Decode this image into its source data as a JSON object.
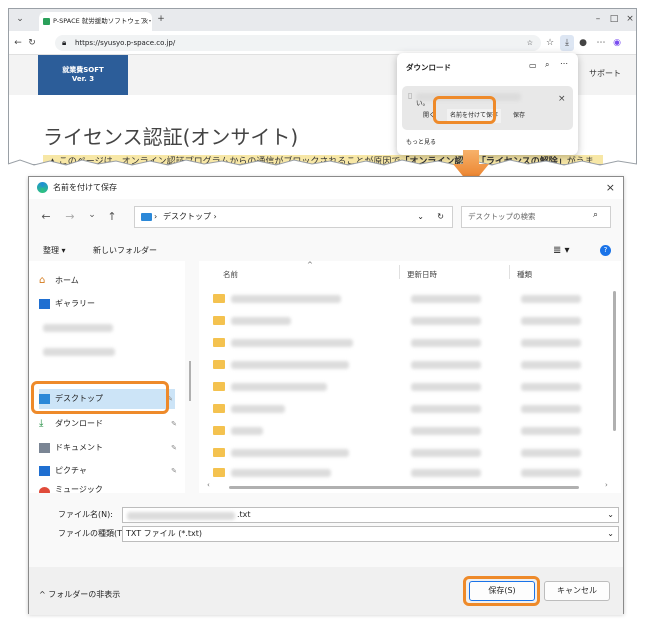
{
  "browser": {
    "tab_title": "P-SPACE 就労援助ソフトウェア・ラ",
    "new_tab_symbol": "+",
    "url": "https://syusyo.p-space.co.jp/",
    "site_logo_line1": "就業費SOFT",
    "site_logo_line2": "Ver. 3",
    "nav_support": "サポート",
    "page_title": "ライセンス認証(オンサイト)",
    "warning_text_1": "このページは、オンライン認証プログラムからの通信がブロックされることが原因で",
    "warning_text_bold1": "「オンライン認証」",
    "warning_text_bold2": "「ライセンスの解除」",
    "warning_text_2": "がうま"
  },
  "downloads": {
    "title": "ダウンロード",
    "item_text": "い。",
    "open_label": "開く",
    "save_as_label": "名前を付けて保存",
    "save_label": "保存",
    "more_label": "もっと見る"
  },
  "dialog": {
    "title": "名前を付けて保存",
    "path_label": "デスクトップ",
    "search_placeholder": "デスクトップの検索",
    "organize_label": "整理 ▾",
    "new_folder_label": "新しいフォルダー",
    "nav_items": [
      {
        "label": "ホーム"
      },
      {
        "label": "ギャラリー"
      },
      {
        "label": "デスクトップ"
      },
      {
        "label": "ダウンロード"
      },
      {
        "label": "ドキュメント"
      },
      {
        "label": "ピクチャ"
      },
      {
        "label": "ミュージック"
      }
    ],
    "columns": {
      "name": "名前",
      "date": "更新日時",
      "type": "種類"
    },
    "filename_label": "ファイル名(N):",
    "filename_value": ".txt",
    "filetype_label": "ファイルの種類(T):",
    "filetype_value": "TXT ファイル (*.txt)",
    "hide_folders_label": "フォルダーの非表示",
    "save_button": "保存(S)",
    "cancel_button": "キャンセル"
  },
  "colors": {
    "highlight": "#ee8a2a",
    "logo_bg": "#2c5d99",
    "warning_bg": "#f7e7a6",
    "folder": "#f4c24f"
  }
}
